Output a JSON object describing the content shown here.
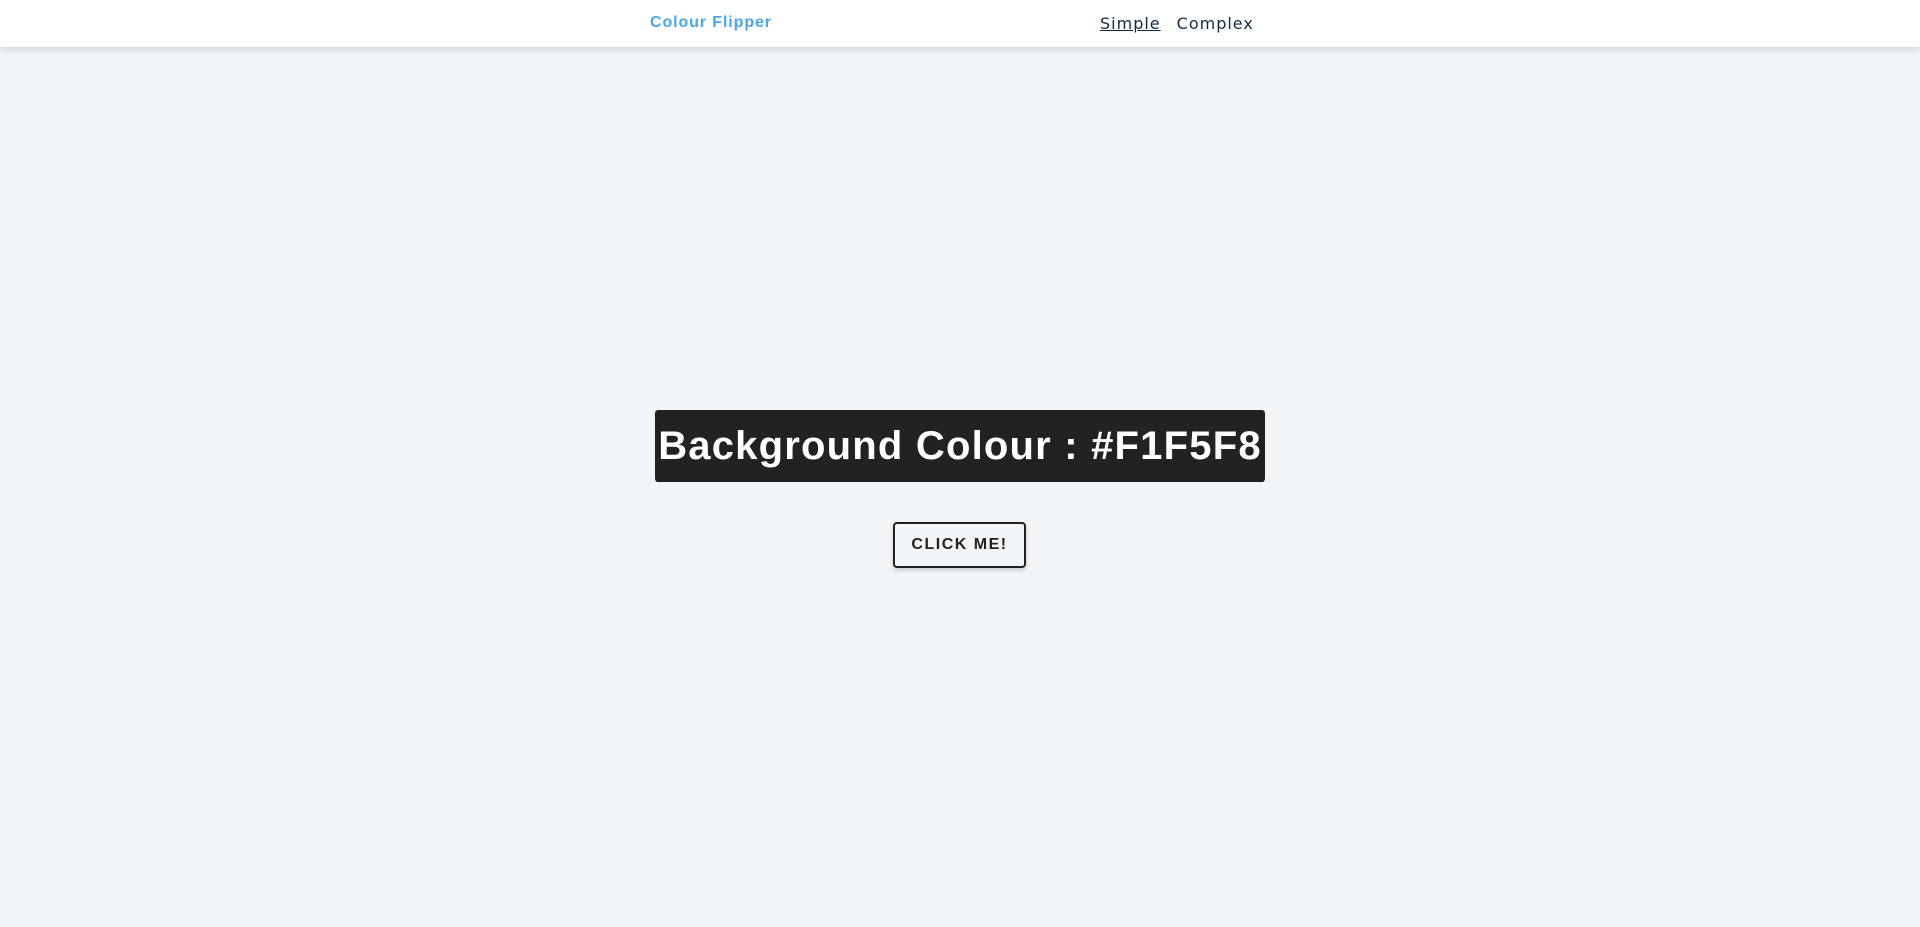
{
  "colors": {
    "page_background": "#F1F5F8",
    "navbar_background": "#FFFFFF",
    "brand": "#49A6E9",
    "nav_text": "#102A42",
    "heading_background": "#222222",
    "heading_text": "#FFFFFF",
    "button_border": "#222222"
  },
  "navbar": {
    "brand": "Colour Flipper",
    "links": [
      {
        "label": "Simple",
        "active": true
      },
      {
        "label": "Complex",
        "active": false
      }
    ]
  },
  "main": {
    "heading_label": "Background Colour : ",
    "color_value": "#F1F5F8",
    "button_label": "CLICK ME!"
  }
}
